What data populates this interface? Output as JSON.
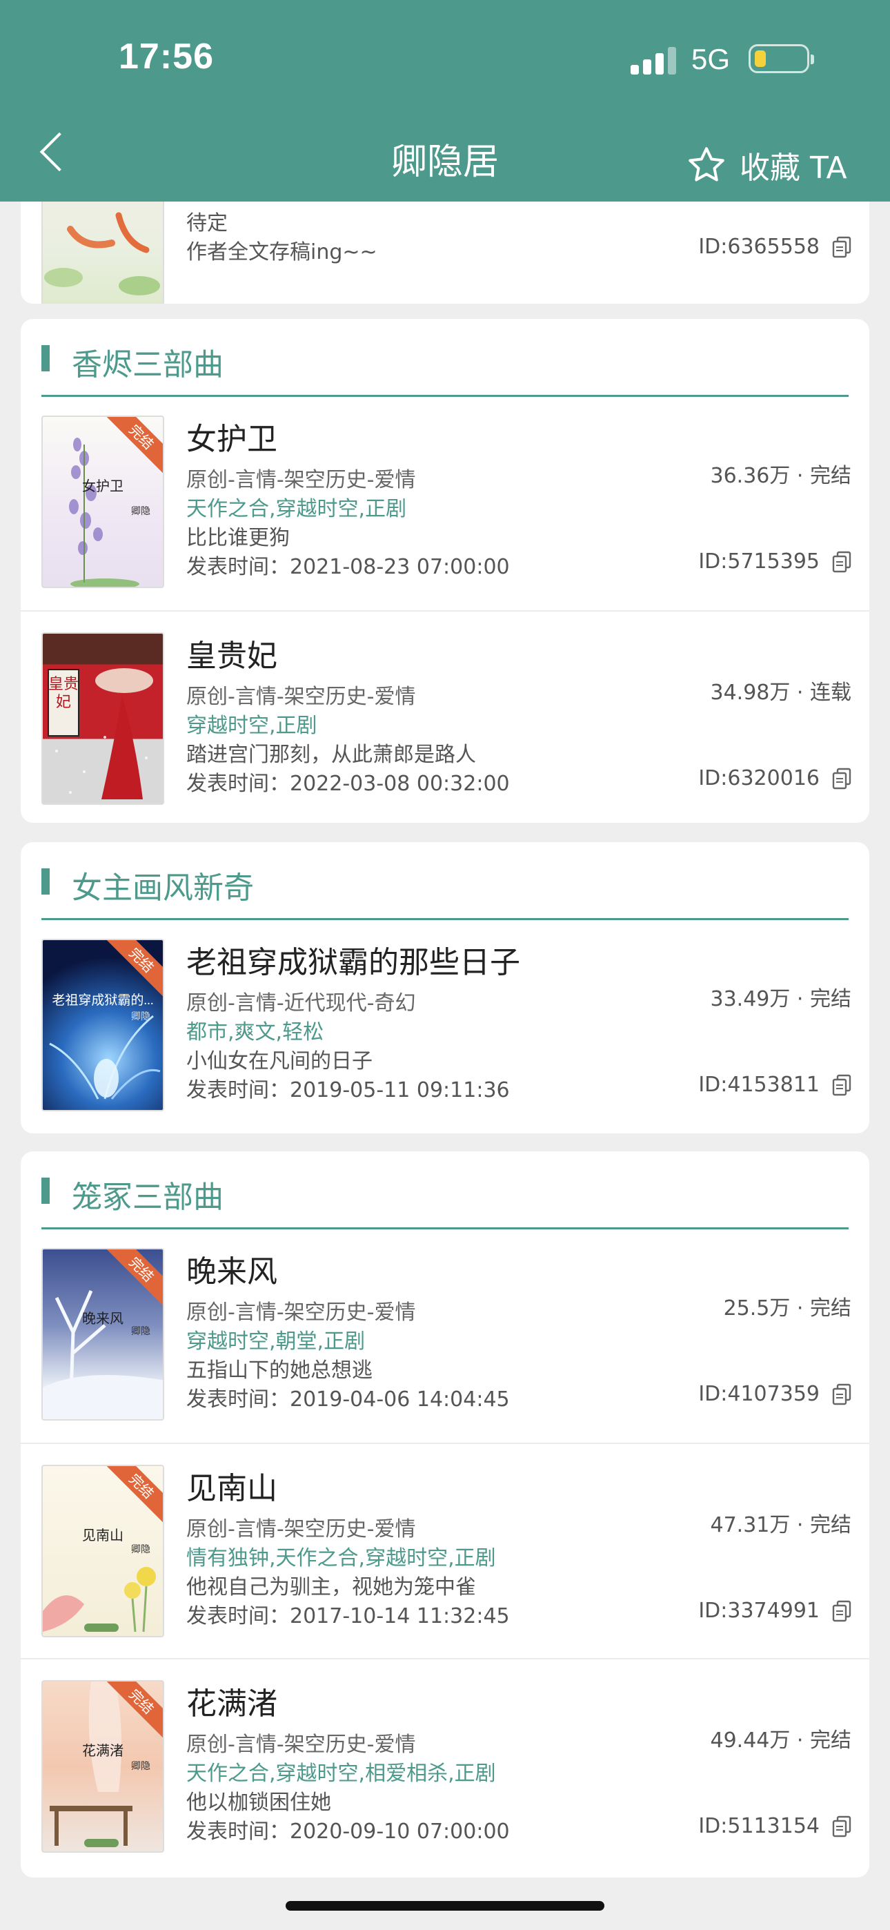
{
  "status": {
    "time": "17:56",
    "network": "5G"
  },
  "nav": {
    "title": "卿隐居",
    "favorite_label": "收藏 TA"
  },
  "top_partial": {
    "desc": "待定",
    "date": "作者全文存稿ing~~",
    "id": "ID:6365558"
  },
  "sections": [
    {
      "title": "香烬三部曲",
      "books": [
        {
          "title": "女护卫",
          "cover_title": "女护卫",
          "cover_author": "卿隐",
          "badge": "完结",
          "category": "原创-言情-架空历史-爱情",
          "tags": "天作之合,穿越时空,正剧",
          "desc": "比比谁更狗",
          "date": "发表时间：2021-08-23 07:00:00",
          "stat": "36.36万 · 完结",
          "id": "ID:5715395"
        },
        {
          "title": "皇贵妃",
          "cover_title": "皇贵妃",
          "cover_author": "",
          "badge": "",
          "category": "原创-言情-架空历史-爱情",
          "tags": "穿越时空,正剧",
          "desc": "踏进宫门那刻，从此萧郎是路人",
          "date": "发表时间：2022-03-08 00:32:00",
          "stat": "34.98万 · 连载",
          "id": "ID:6320016"
        }
      ]
    },
    {
      "title": "女主画风新奇",
      "books": [
        {
          "title": "老祖穿成狱霸的那些日子",
          "cover_title": "老祖穿成狱霸的...",
          "cover_author": "卿隐",
          "badge": "完结",
          "category": "原创-言情-近代现代-奇幻",
          "tags": "都市,爽文,轻松",
          "desc": "小仙女在凡间的日子",
          "date": "发表时间：2019-05-11 09:11:36",
          "stat": "33.49万 · 完结",
          "id": "ID:4153811"
        }
      ]
    },
    {
      "title": "笼冢三部曲",
      "books": [
        {
          "title": "晚来风",
          "cover_title": "晚来风",
          "cover_author": "卿隐",
          "badge": "完结",
          "category": "原创-言情-架空历史-爱情",
          "tags": "穿越时空,朝堂,正剧",
          "desc": "五指山下的她总想逃",
          "date": "发表时间：2019-04-06 14:04:45",
          "stat": "25.5万 · 完结",
          "id": "ID:4107359"
        },
        {
          "title": "见南山",
          "cover_title": "见南山",
          "cover_author": "卿隐",
          "badge": "完结",
          "category": "原创-言情-架空历史-爱情",
          "tags": "情有独钟,天作之合,穿越时空,正剧",
          "desc": "他视自己为驯主，视她为笼中雀",
          "date": "发表时间：2017-10-14 11:32:45",
          "stat": "47.31万 · 完结",
          "id": "ID:3374991"
        },
        {
          "title": "花满渚",
          "cover_title": "花满渚",
          "cover_author": "卿隐",
          "badge": "完结",
          "category": "原创-言情-架空历史-爱情",
          "tags": "天作之合,穿越时空,相爱相杀,正剧",
          "desc": "他以枷锁困住她",
          "date": "发表时间：2020-09-10 07:00:00",
          "stat": "49.44万 · 完结",
          "id": "ID:5113154"
        }
      ]
    }
  ],
  "colors": {
    "accent": "#4d9a8c",
    "badge": "#e0663a"
  },
  "icons": [
    "back-arrow-icon",
    "star-icon",
    "copy-icon",
    "signal-icon",
    "battery-icon"
  ]
}
